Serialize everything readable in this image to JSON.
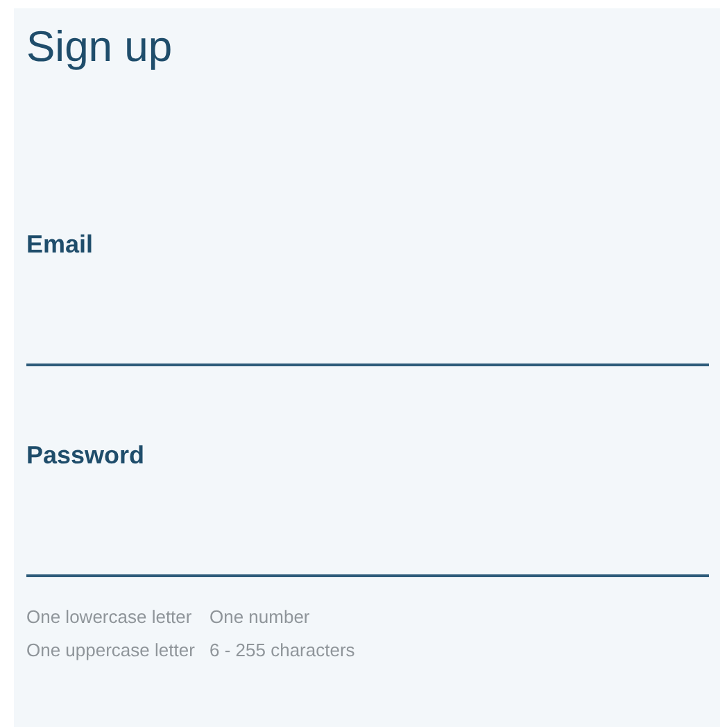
{
  "title": "Sign up",
  "fields": [
    {
      "label": "Email"
    },
    {
      "label": "Password"
    }
  ],
  "requirements": [
    "One lowercase letter",
    "One number",
    "One uppercase letter",
    "6 - 255 characters"
  ]
}
